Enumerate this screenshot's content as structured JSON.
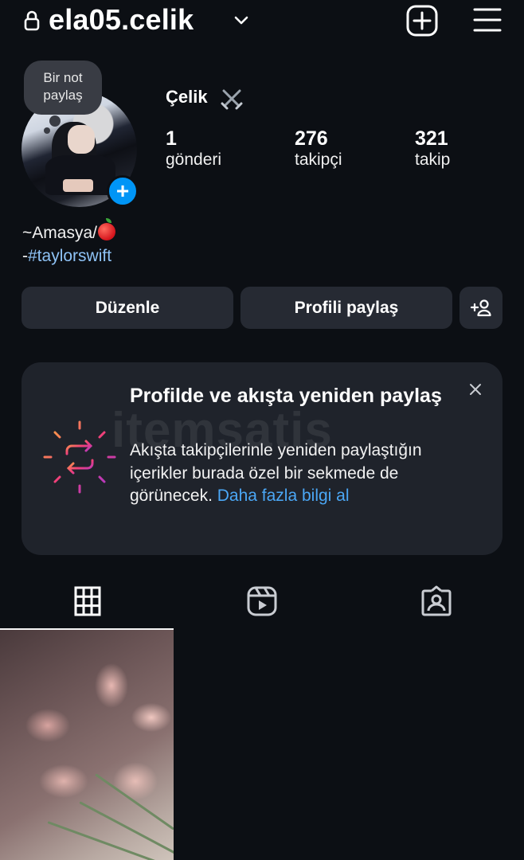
{
  "header": {
    "username": "ela05.celik"
  },
  "profile": {
    "note": "Bir not paylaş",
    "display_name": "Çelik",
    "stats": [
      {
        "value": "1",
        "label": "gönderi"
      },
      {
        "value": "276",
        "label": "takipçi"
      },
      {
        "value": "321",
        "label": "takip"
      }
    ],
    "bio_line1": "~Amasya/",
    "bio_line2_prefix": "-",
    "bio_hashtag": "#taylorswift"
  },
  "actions": {
    "edit_label": "Düzenle",
    "share_label": "Profili paylaş"
  },
  "repost_card": {
    "title": "Profilde ve akışta yeniden paylaş",
    "body": "Akışta takipçilerinle yeniden paylaştığın içerikler burada özel bir sekmede de görünecek.",
    "link": "Daha fazla bilgi al"
  },
  "watermark": "itemsatis",
  "tabs": [
    {
      "name": "posts",
      "icon": "grid-icon",
      "active": true
    },
    {
      "name": "reels",
      "icon": "reels-icon",
      "active": false
    },
    {
      "name": "tagged",
      "icon": "tagged-icon",
      "active": false
    }
  ],
  "colors": {
    "background": "#0c0f14",
    "button": "#262a33",
    "card": "#1f232b",
    "accent": "#0095f6",
    "link": "#4ba7f5",
    "hashtag": "#8ec2f5"
  }
}
